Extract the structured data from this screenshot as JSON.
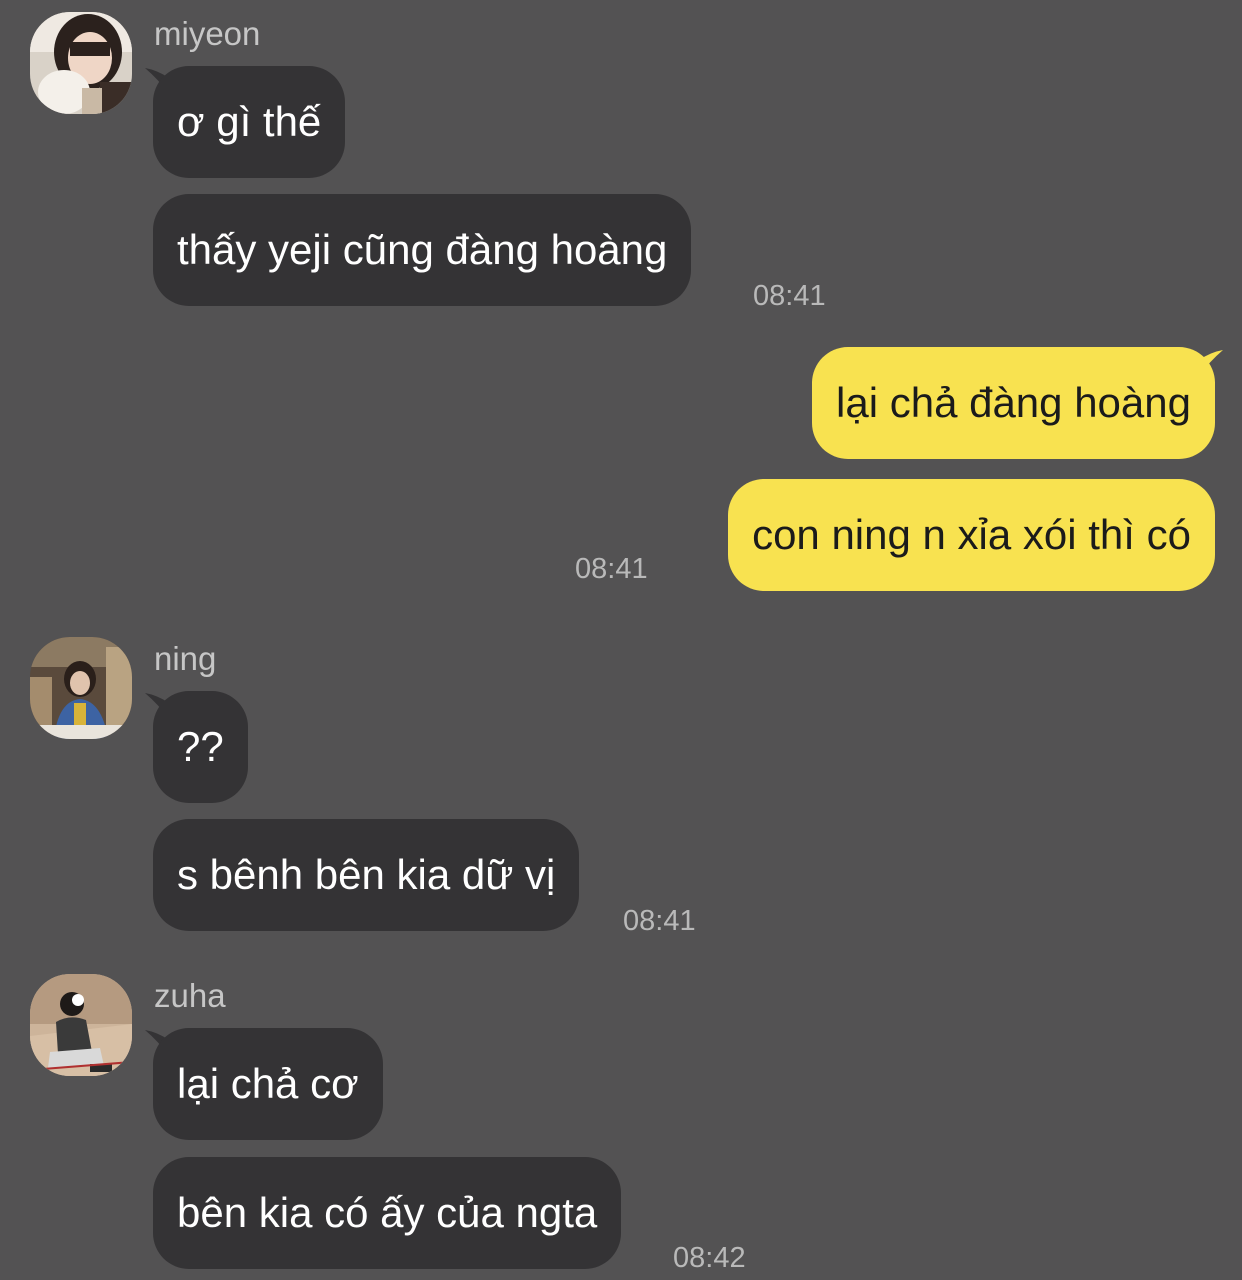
{
  "messages": {
    "m1": {
      "sender": "miyeon",
      "avatar_icon": "profile-photo-miyeon",
      "bubble1": "ơ gì thế",
      "bubble2": "thấy yeji cũng đàng hoàng",
      "time": "08:41"
    },
    "me": {
      "bubble1": "lại chả đàng hoàng",
      "bubble2": "con ning n xỉa xói thì có",
      "time": "08:41"
    },
    "m2": {
      "sender": "ning",
      "avatar_icon": "profile-photo-ning",
      "bubble1": "??",
      "bubble2": "s bênh bên kia dữ vị",
      "time": "08:41"
    },
    "m3": {
      "sender": "zuha",
      "avatar_icon": "profile-photo-zuha",
      "bubble1": "lại chả cơ",
      "bubble2": "bên kia có ấy của ngta",
      "time": "08:42"
    }
  },
  "colors": {
    "background": "#535253",
    "incoming_bubble": "#343335",
    "outgoing_bubble": "#f8e250",
    "sender_name": "#c6c6c6",
    "timestamp": "#b9b9b9"
  }
}
